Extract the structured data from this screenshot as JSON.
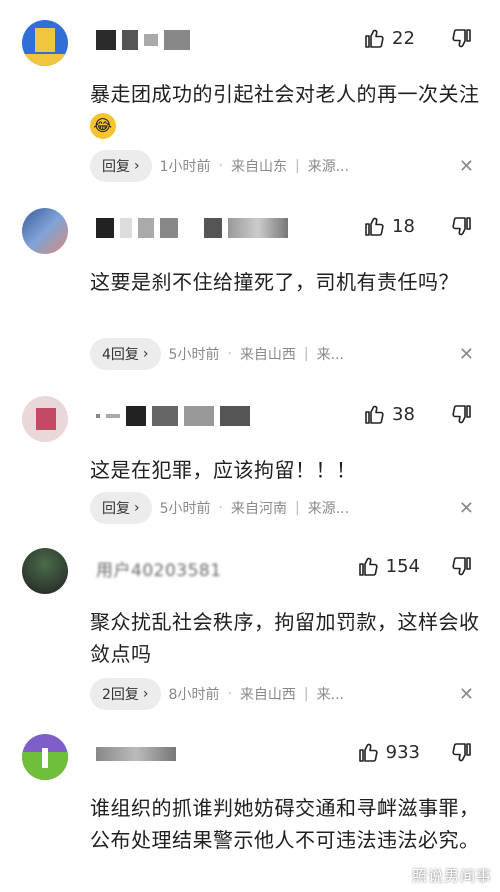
{
  "comments": [
    {
      "username": "",
      "likes": "22",
      "text": "暴走团成功的引起社会对老人的再一次关注",
      "emoji": "😂",
      "reply_label": "回复",
      "time": "1小时前",
      "location": "来自山东",
      "source": "来源..."
    },
    {
      "username": "",
      "likes": "18",
      "text": "这要是刹不住给撞死了，司机有责任吗？",
      "reply_label": "4回复",
      "time": "5小时前",
      "location": "来自山西",
      "source": "来..."
    },
    {
      "username": "",
      "likes": "38",
      "text": "这是在犯罪，应该拘留！！！",
      "reply_label": "回复",
      "time": "5小时前",
      "location": "来自河南",
      "source": "来源..."
    },
    {
      "username": "用户40203581",
      "likes": "154",
      "text": "聚众扰乱社会秩序，拘留加罚款，这样会收敛点吗",
      "reply_label": "2回复",
      "time": "8小时前",
      "location": "来自山西",
      "source": "来..."
    },
    {
      "username": "",
      "likes": "933",
      "text": "谁组织的抓谁判她妨碍交通和寻衅滋事罪，公布处理结果警示他人不可违法违法必究。"
    }
  ],
  "watermark": "照说男间事",
  "colors": {
    "background": "#ffffff",
    "reply_bg": "#ececec",
    "meta": "#8a8a8a"
  }
}
